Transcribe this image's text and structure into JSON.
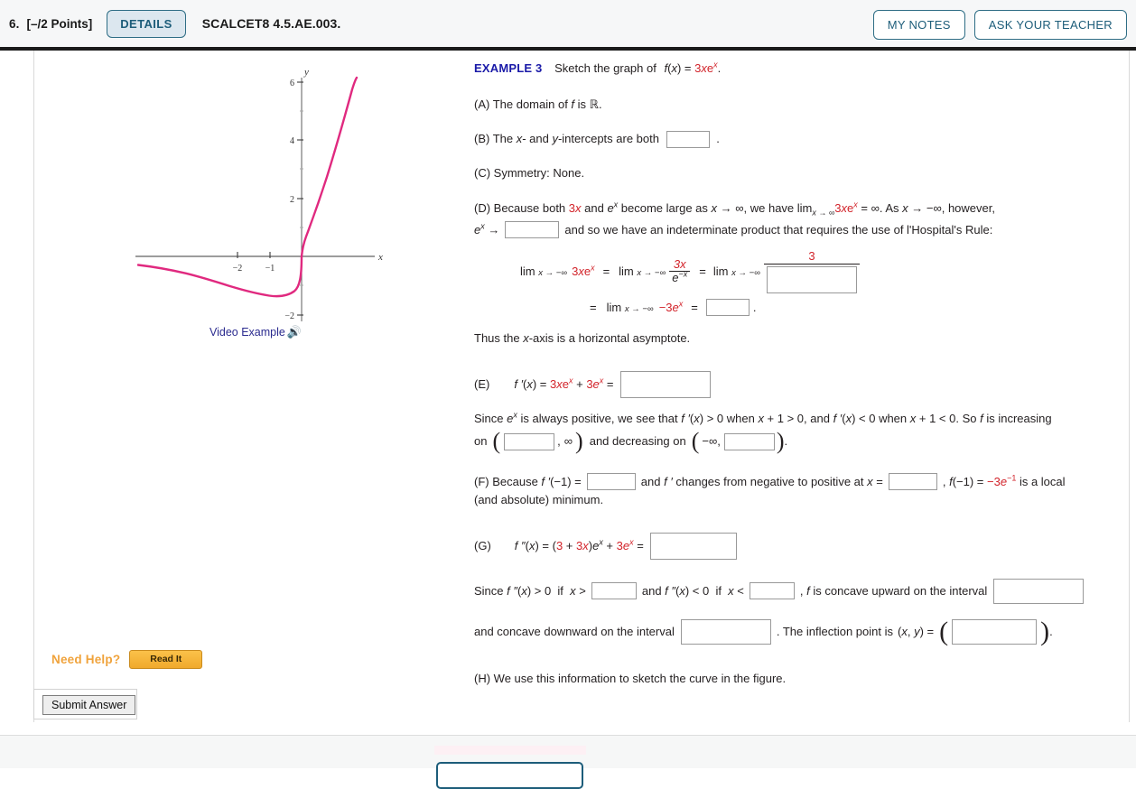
{
  "header": {
    "question_number": "6.",
    "points": "[–/2 Points]",
    "details_label": "DETAILS",
    "assignment_id": "SCALCET8 4.5.AE.003.",
    "my_notes_label": "MY NOTES",
    "ask_teacher_label": "ASK YOUR TEACHER"
  },
  "figure": {
    "video_example_label": "Video Example",
    "speaker_icon": "speaker-icon",
    "x_axis_label": "x",
    "y_axis_label": "y",
    "x_ticks": [
      "−2",
      "−1"
    ],
    "y_ticks": [
      "6",
      "4",
      "2",
      "−2"
    ],
    "curve_color": "#e0297f"
  },
  "chart_data": {
    "type": "line",
    "title": "",
    "xlabel": "x",
    "ylabel": "y",
    "function": "f(x) = 3xe^x",
    "xlim": [
      -3.6,
      0.9
    ],
    "ylim": [
      -2,
      6.3
    ],
    "x_tick_values": [
      -2,
      -1
    ],
    "x_tick_labels": [
      "−2",
      "−1"
    ],
    "y_tick_values": [
      -2,
      2,
      4,
      6
    ],
    "y_tick_labels": [
      "−2",
      "2",
      "4",
      "6"
    ],
    "grid": false,
    "legend": null,
    "series": [
      {
        "name": "3xe^x",
        "x": [
          -3.6,
          -3.4,
          -3.2,
          -3.0,
          -2.8,
          -2.6,
          -2.4,
          -2.2,
          -2.0,
          -1.8,
          -1.6,
          -1.4,
          -1.2,
          -1.0,
          -0.8,
          -0.6,
          -0.4,
          -0.2,
          0.0,
          0.2,
          0.4,
          0.6,
          0.72
        ],
        "y": [
          -0.295,
          -0.344,
          -0.391,
          -0.448,
          -0.511,
          -0.579,
          -0.653,
          -0.732,
          -0.812,
          -0.893,
          -0.969,
          -1.036,
          -1.084,
          -1.104,
          -1.078,
          -0.988,
          -0.805,
          -0.491,
          0.0,
          0.733,
          1.79,
          3.28,
          4.87
        ]
      }
    ],
    "annotations": [
      "minimum near x = -1"
    ]
  },
  "content": {
    "example_label": "EXAMPLE 3",
    "example_prompt": "Sketch the graph of",
    "example_fn_plain": "f(x) = 3xe^x.",
    "a_text": "(A) The domain of f is ℝ.",
    "b_prefix": "(B) The x- and y-intercepts are both",
    "b_suffix": ".",
    "c_text": "(C) Symmetry: None.",
    "d_line1_p1": "(D) Because both",
    "d_line1_3x": "3x",
    "d_line1_p2": "and",
    "d_line1_ex": "e",
    "d_line1_p3": "become large as",
    "d_line1_lim1": "x → ∞,",
    "d_line1_p4": "we have",
    "d_line1_lim2": "lim",
    "d_line1_sub": "x → ∞",
    "d_line1_3xex": "3xe",
    "d_line1_inf": "= ∞.",
    "d_line1_p5": "As",
    "d_line1_lim3": "x → −∞,",
    "d_line1_p6": "however,",
    "d_line2_p1": "e",
    "d_line2_arrow": "→",
    "d_line2_p2": "and so we have an indeterminate product that requires the use of l'Hospital's Rule:",
    "lim_label": "lim",
    "lim_sub": "x → −∞",
    "eq_3xex": "3xe",
    "eq_equals": "=",
    "frac1_num": "3x",
    "frac1_den": "e",
    "frac1_den_sup": "−x",
    "frac2_num": "3",
    "eq_neg3ex": "−3e",
    "eq_period": ".",
    "asymptote_text": "Thus the x-axis is a horizontal asymptote.",
    "e_label": "(E)",
    "e_expr_p1": "f ′(x) =",
    "e_expr_3xex": "3xe",
    "e_expr_plus": "+",
    "e_expr_3ex": "3e",
    "e_expr_eq": "=",
    "since_ex_p1": "Since",
    "since_ex_ex": "e",
    "since_ex_p2": "is always positive, we see that",
    "since_ex_p3": "f ′(x) > 0",
    "since_ex_p4": "when",
    "since_ex_p5": "x + 1 > 0,",
    "since_ex_p6": "and",
    "since_ex_p7": "f ′(x) < 0",
    "since_ex_p8": "when",
    "since_ex_p9": "x + 1 < 0.",
    "since_ex_p10": "So f is increasing",
    "on_label": "on",
    "inf_label": "∞",
    "and_decreasing_label": "and decreasing on",
    "neg_inf_label": "−∞,",
    "f_label_p1": "(F) Because",
    "f_label_fprime": "f ′(−1) =",
    "f_label_p2": "and",
    "f_label_p3": "f ′",
    "f_label_p4": "changes from negative to positive at",
    "f_label_x": "x =",
    "f_label_p5": ",",
    "f_label_p6": "f(−1) =",
    "f_label_val": "−3e",
    "f_label_val_sup": "−1",
    "f_label_p7": "is a local",
    "f_label_line2": "(and absolute) minimum.",
    "g_label": "(G)",
    "g_expr_p1": "f ″(x) = (",
    "g_expr_3": "3",
    "g_expr_plus1": "+",
    "g_expr_3x": "3x",
    "g_expr_p2": ")e",
    "g_expr_plus2": "+",
    "g_expr_3ex": "3e",
    "g_expr_eq": "=",
    "since_fpp_p1": "Since",
    "since_fpp_p2": "f ″(x) > 0",
    "since_fpp_p3": "if",
    "since_fpp_p4": "x >",
    "since_fpp_p5": "and",
    "since_fpp_p6": "f ″(x) < 0",
    "since_fpp_p7": "if",
    "since_fpp_p8": "x <",
    "since_fpp_p9": ",",
    "since_fpp_p10": "f is concave upward on the interval",
    "concave_down_p1": "and concave downward on the interval",
    "concave_down_p2": ". The inflection point is",
    "concave_down_xy": "(x, y) =",
    "concave_down_p3": ".",
    "h_text": "(H) We use this information to sketch the curve in the figure."
  },
  "help": {
    "need_help_label": "Need Help?",
    "read_it_label": "Read It"
  },
  "submit": {
    "submit_label": "Submit Answer"
  }
}
